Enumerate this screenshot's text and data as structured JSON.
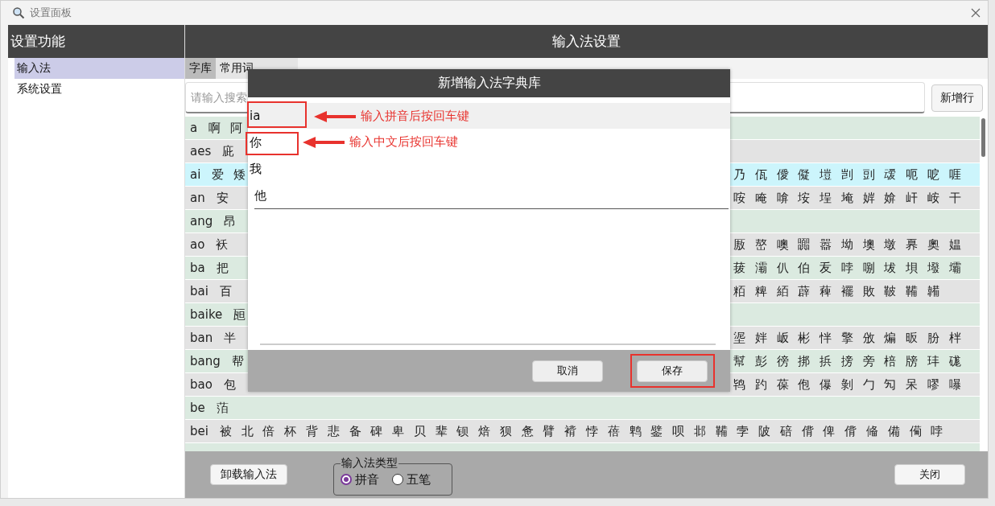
{
  "window": {
    "title": "设置面板"
  },
  "sidebar": {
    "title": "设置功能",
    "items": [
      {
        "label": "输入法",
        "selected": true
      },
      {
        "label": "系统设置",
        "selected": false
      }
    ]
  },
  "main": {
    "title": "输入法设置",
    "tabs": [
      {
        "label": "字库",
        "selected": true
      },
      {
        "label": "常用词",
        "selected": false
      }
    ],
    "search": {
      "placeholder": "请输入搜索"
    },
    "add_row_button": "新增行",
    "rows": [
      {
        "pinyin": "a",
        "chars_left": "啊 阿",
        "chars_right": "",
        "selected": false
      },
      {
        "pinyin": "aes",
        "chars_left": "庛",
        "chars_right": "",
        "selected": false
      },
      {
        "pinyin": "ai",
        "chars_left": "爱 矮",
        "chars_right": "乃 佤 僾 儗 塏 剀 剅 叆 呃 呝 啀",
        "selected": true
      },
      {
        "pinyin": "an",
        "chars_left": "安",
        "chars_right": "咹 唵 啽 垵 埕 埯 婩 媕 屽 峖 干",
        "selected": false
      },
      {
        "pinyin": "ang",
        "chars_left": "昂",
        "chars_right": "",
        "selected": false
      },
      {
        "pinyin": "ao",
        "chars_left": "袄",
        "chars_right": "厫 嶅 噢 嚻 嚣 坳 墺 墩 奡 奧 媪",
        "selected": false
      },
      {
        "pinyin": "ba",
        "chars_left": "把",
        "chars_right": "菝 灞 仈 伯 叐 哱 哵 坺 垻 墢 壩",
        "selected": false
      },
      {
        "pinyin": "bai",
        "chars_left": "百",
        "chars_right": "粨 粺 絔 薜 薭 襬 敗 鞁 鞴 韛",
        "selected": false
      },
      {
        "pinyin": "baike",
        "chars_left": "瓸",
        "chars_right": "",
        "selected": false
      },
      {
        "pinyin": "ban",
        "chars_left": "半",
        "chars_right": "埿 姅 岅 彬 怑 擎 攽 煸 昄 朌 柈",
        "selected": false
      },
      {
        "pinyin": "bang",
        "chars_left": "帮",
        "chars_right": "幫 彭 徬 挷 捠 搒 旁 棓 牓 玤 硥",
        "selected": false
      },
      {
        "pinyin": "bao",
        "chars_left": "包",
        "chars_right": "鸨 趵 葆 佨 儤 剝 勹 勼 呆 嘐 嚗",
        "selected": false
      },
      {
        "pinyin": "be",
        "chars": "萡",
        "selected": false
      },
      {
        "pinyin": "bei",
        "chars": "被 北 倍 杯 背 悲 备 碑 卑 贝 辈 钡 焙 狈 惫 臂 褙 悖 蓓 鹎 鐾 呗 邶 鞴 孛 陂 碚 偝 俾 偝 偹 備 僃 哱",
        "selected": false
      }
    ],
    "uninstall_button": "卸载输入法",
    "type_group": {
      "title": "输入法类型",
      "options": [
        {
          "label": "拼音",
          "selected": true
        },
        {
          "label": "五笔",
          "selected": false
        }
      ]
    },
    "close_button": "关闭"
  },
  "dialog": {
    "title": "新增输入法字典库",
    "items": [
      {
        "text": "ia",
        "kind": "field",
        "selected": true
      },
      {
        "text": "你",
        "kind": "field",
        "selected": false
      },
      {
        "text": "我",
        "kind": "item",
        "selected": false
      },
      {
        "text": "他",
        "kind": "editing",
        "selected": false
      }
    ],
    "buttons": [
      {
        "label": "取消"
      },
      {
        "label": "保存"
      }
    ]
  },
  "annotations": [
    {
      "text": "输入拼音后按回车键"
    },
    {
      "text": "输入中文后按回车键"
    }
  ]
}
